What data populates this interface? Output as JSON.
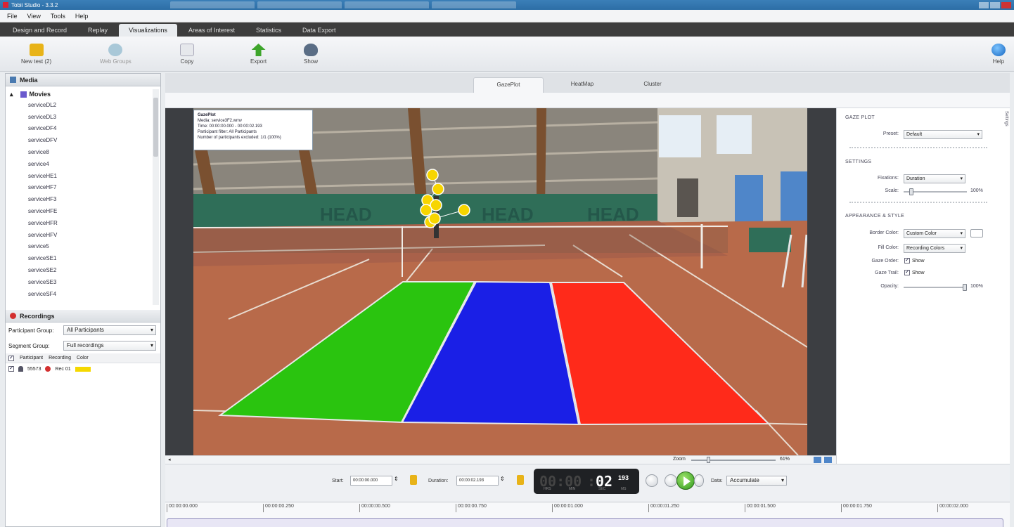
{
  "window": {
    "title": "Tobii Studio - 3.3.2"
  },
  "menu": [
    "File",
    "View",
    "Tools",
    "Help"
  ],
  "main_tabs": [
    "Design and Record",
    "Replay",
    "Visualizations",
    "Areas of Interest",
    "Statistics",
    "Data Export"
  ],
  "toolbar": {
    "new_test": "New test (2)",
    "web_groups": "Web Groups",
    "copy": "Copy",
    "export": "Export",
    "show": "Show",
    "help": "Help"
  },
  "media": {
    "header": "Media",
    "root": "Movies",
    "items": [
      "serviceDL2",
      "serviceDL3",
      "serviceDF4",
      "serviceDFV",
      "service8",
      "service4",
      "serviceHE1",
      "serviceHF7",
      "serviceHF3",
      "serviceHFE",
      "serviceHFR",
      "serviceHFV",
      "service5",
      "serviceSE1",
      "serviceSE2",
      "serviceSE3",
      "serviceSF4"
    ]
  },
  "recordings": {
    "header": "Recordings",
    "participant_group_label": "Participant Group:",
    "participant_group_value": "All Participants",
    "segment_group_label": "Segment Group:",
    "segment_group_value": "Full recordings",
    "columns": [
      "Participant",
      "Recording",
      "Color"
    ],
    "rows": [
      {
        "participant": "55573",
        "recording": "Rec 01"
      }
    ]
  },
  "viz_tabs": [
    "GazePlot",
    "HeatMap",
    "Cluster"
  ],
  "info_box": {
    "title": "GazePlot",
    "media": "Media: service3F2.wmv",
    "time": "Time: 00:00:00.000 - 00:00:02.193",
    "participant_filter": "Participant filter: All Participants",
    "excluded": "Number of participants excluded: 1/1 (100%)"
  },
  "settings": {
    "side_tab": "Settings",
    "gaze_plot_heading": "GAZE PLOT",
    "preset_label": "Preset:",
    "preset_value": "Default",
    "settings_heading": "SETTINGS",
    "fixations_label": "Fixations:",
    "fixations_value": "Duration",
    "scale_label": "Scale:",
    "scale_value": "100%",
    "scale_fraction": 0.1,
    "appearance_heading": "APPEARANCE & STYLE",
    "border_color_label": "Border Color:",
    "border_color_value": "Custom Color",
    "fill_color_label": "Fill Color:",
    "fill_color_value": "Recording Colors",
    "gaze_order_label": "Gaze Order:",
    "gaze_order_value": "Show",
    "gaze_trail_label": "Gaze Trail:",
    "gaze_trail_value": "Show",
    "opacity_label": "Opacity:",
    "opacity_value": "100%",
    "opacity_fraction": 1.0
  },
  "zoom": {
    "label": "Zoom",
    "value": "61%"
  },
  "playback": {
    "start_label": "Start:",
    "start_value": "00:00:00.000",
    "duration_label": "Duration:",
    "duration_value": "00:00:02.193",
    "timecode_hidden": "00:00",
    "timecode_seconds": "02",
    "timecode_ms": "193",
    "timecode_sub": [
      "HRS",
      "MIN",
      "SEC",
      "MS"
    ],
    "data_label": "Data:",
    "data_value": "Accumulate"
  },
  "timeline": [
    "00:00:00.000",
    "00:00:00.250",
    "00:00:00.500",
    "00:00:00.750",
    "00:00:01.000",
    "00:00:01.250",
    "00:00:01.500",
    "00:00:01.750",
    "00:00:02.000"
  ],
  "colors": {
    "zone_left": "#2ac40f",
    "zone_middle": "#1a1fe6",
    "zone_right": "#ff2a1a",
    "fixation": "#f7d500",
    "clay": "#b86a4a"
  }
}
